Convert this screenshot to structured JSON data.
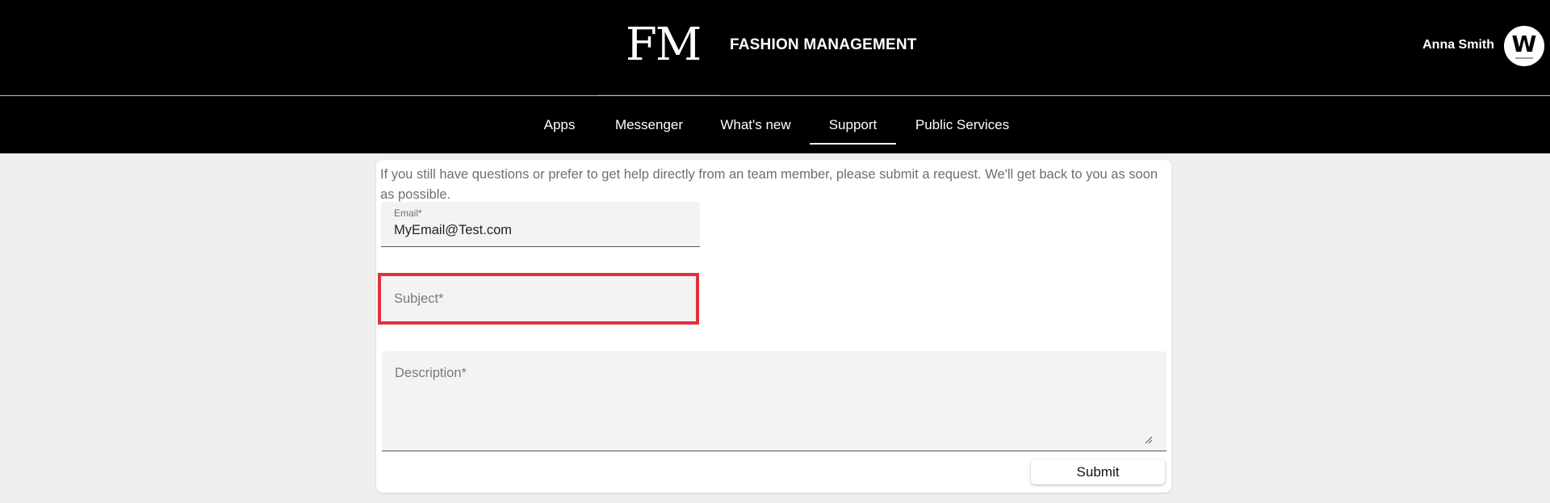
{
  "header": {
    "logo": "FM",
    "brand_title": "FASHION MANAGEMENT",
    "user_name": "Anna Smith",
    "avatar_letter": "W"
  },
  "nav": {
    "items": [
      {
        "label": "Apps",
        "active": false
      },
      {
        "label": "Messenger",
        "active": false
      },
      {
        "label": "What's new",
        "active": false
      },
      {
        "label": "Support",
        "active": true
      },
      {
        "label": "Public Services",
        "active": false
      }
    ]
  },
  "support_form": {
    "intro": "If you still have questions or prefer to get help directly from an team member, please submit a request. We'll get back to you as soon as possible.",
    "email": {
      "label": "Email*",
      "value": "MyEmail@Test.com"
    },
    "subject": {
      "placeholder": "Subject*"
    },
    "description": {
      "placeholder": "Description*"
    },
    "submit_label": "Submit"
  },
  "colors": {
    "header_bg": "#000000",
    "page_bg": "#efefef",
    "highlight": "#e2323c"
  }
}
